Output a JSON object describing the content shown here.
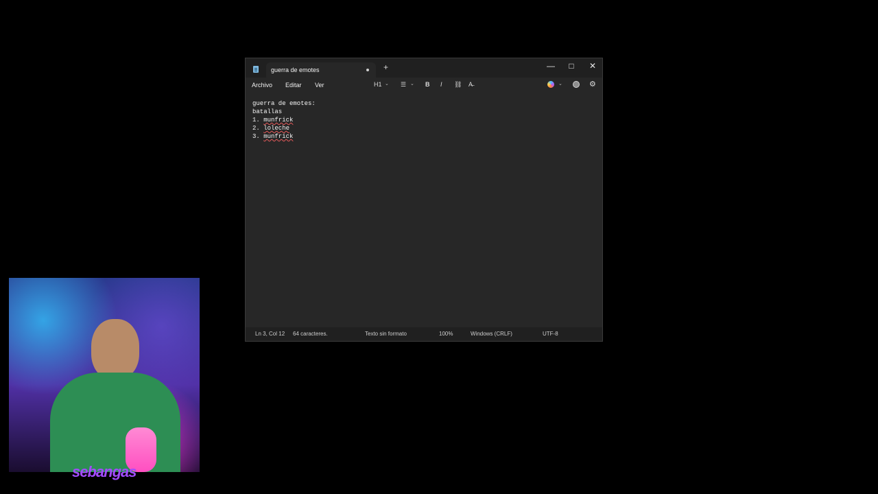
{
  "window": {
    "tab_title": "guerra de emotes",
    "new_tab_label": "+",
    "minimize_label": "—",
    "maximize_label": "□",
    "close_label": "✕"
  },
  "menu": {
    "file": "Archivo",
    "edit": "Editar",
    "view": "Ver"
  },
  "toolbar": {
    "heading": "H1",
    "list": "☰",
    "bold": "B",
    "italic": "I",
    "link": "⛓",
    "clear_formatting": "A̶"
  },
  "document": {
    "lines": [
      "guerra de emotes:",
      "batallas",
      "1. munfrick",
      "2. loleche",
      "3. munfrick"
    ],
    "list_prefixes": [
      "1. ",
      "2. ",
      "3. "
    ],
    "list_words": [
      "munfrick",
      "loleche",
      "munfrick"
    ]
  },
  "status": {
    "position": "Ln 3, Col 12",
    "chars": "64 caracteres.",
    "format": "Texto sin formato",
    "zoom": "100%",
    "line_endings": "Windows (CRLF)",
    "encoding": "UTF-8"
  },
  "overlay": {
    "brand": "sebangas"
  }
}
